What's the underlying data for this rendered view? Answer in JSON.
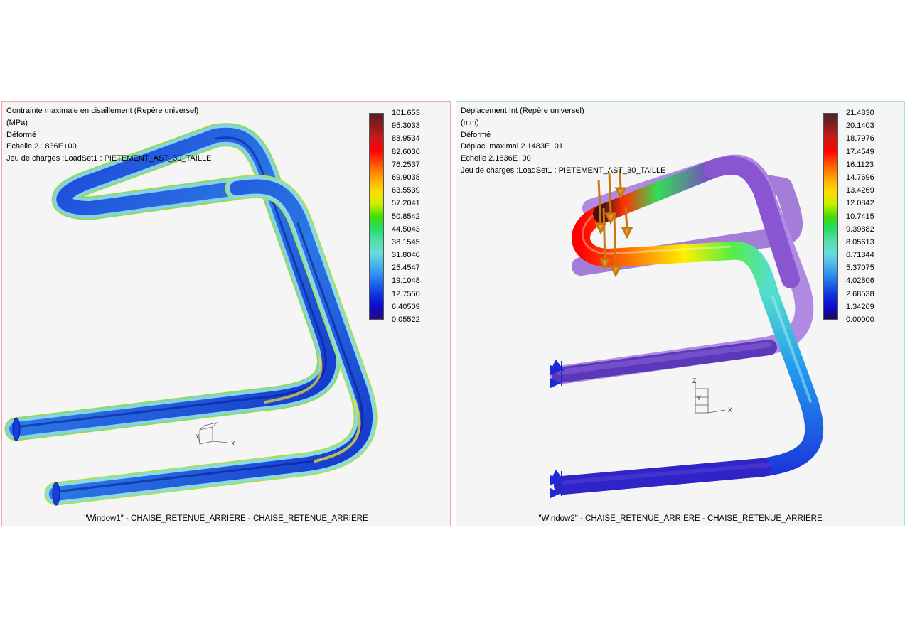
{
  "window1": {
    "info_lines": [
      "Contrainte maximale en cisaillement (Repère universel)",
      "(MPa)",
      "Déformé",
      "Echelle  2.1836E+00",
      "Jeu de charges :LoadSet1 :  PIETEMENT_AST_30_TAILLE"
    ],
    "legend": [
      "101.653",
      "95.3033",
      "88.9534",
      "82.6036",
      "76.2537",
      "69.9038",
      "63.5539",
      "57.2041",
      "50.8542",
      "44.5043",
      "38.1545",
      "31.8046",
      "25.4547",
      "19.1048",
      "12.7550",
      "6.40509",
      "0.05522"
    ],
    "axis_labels": {
      "x": "X",
      "y": "Y"
    },
    "caption": "\"Window1\" - CHAISE_RETENUE_ARRIERE - CHAISE_RETENUE_ARRIERE"
  },
  "window2": {
    "info_lines": [
      "Déplacement Int (Repère universel)",
      "(mm)",
      "Déformé",
      "Déplac. maximal  2.1483E+01",
      "Echelle  2.1836E+00",
      "Jeu de charges :LoadSet1 :  PIETEMENT_AST_30_TAILLE"
    ],
    "legend": [
      "21.4830",
      "20.1403",
      "18.7976",
      "17.4549",
      "16.1123",
      "14.7696",
      "13.4269",
      "12.0842",
      "10.7415",
      "9.39882",
      "8.05613",
      "6.71344",
      "5.37075",
      "4.02806",
      "2.68538",
      "1.34269",
      "0.00000"
    ],
    "axis_labels": {
      "x": "X",
      "y": "Y",
      "z": "Z"
    },
    "caption": "\"Window2\" - CHAISE_RETENUE_ARRIERE - CHAISE_RETENUE_ARRIERE"
  }
}
